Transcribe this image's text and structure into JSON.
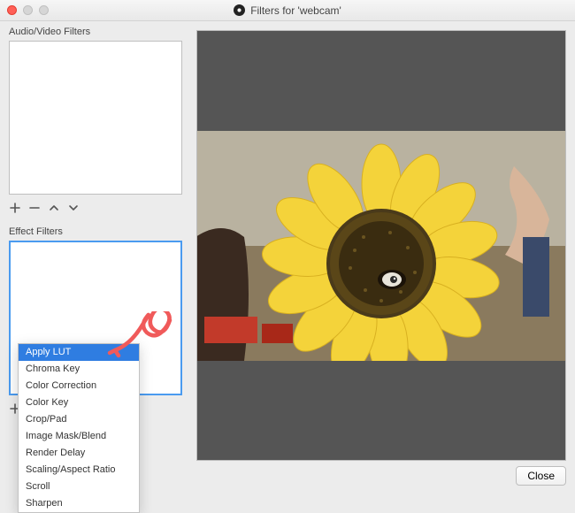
{
  "window": {
    "title": "Filters for 'webcam'"
  },
  "sections": {
    "audioVideo": {
      "label": "Audio/Video Filters"
    },
    "effect": {
      "label": "Effect Filters"
    }
  },
  "popupMenu": {
    "items": [
      {
        "label": "Apply LUT",
        "selected": true
      },
      {
        "label": "Chroma Key",
        "selected": false
      },
      {
        "label": "Color Correction",
        "selected": false
      },
      {
        "label": "Color Key",
        "selected": false
      },
      {
        "label": "Crop/Pad",
        "selected": false
      },
      {
        "label": "Image Mask/Blend",
        "selected": false
      },
      {
        "label": "Render Delay",
        "selected": false
      },
      {
        "label": "Scaling/Aspect Ratio",
        "selected": false
      },
      {
        "label": "Scroll",
        "selected": false
      },
      {
        "label": "Sharpen",
        "selected": false
      }
    ]
  },
  "buttons": {
    "close": "Close"
  },
  "annotation": {
    "color": "#f05a5a"
  }
}
